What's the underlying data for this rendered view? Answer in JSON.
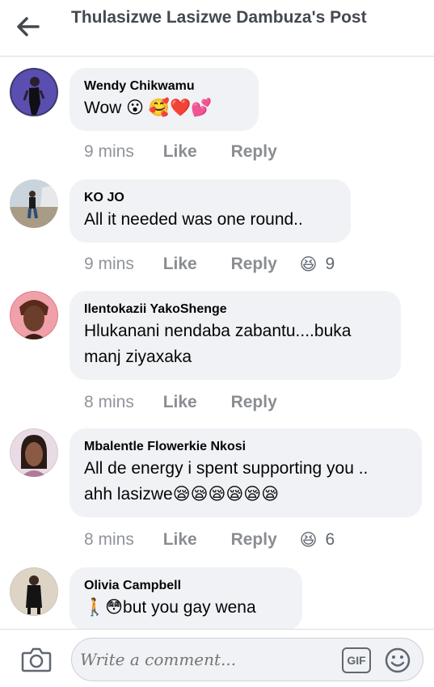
{
  "header": {
    "title": "Thulasizwe Lasizwe Dambuza's Post"
  },
  "comments": [
    {
      "author": "Wendy Chikwamu",
      "text": "Wow 😮 🥰❤️💕",
      "time": "9 mins",
      "like": "Like",
      "reply": "Reply",
      "reaction_count": ""
    },
    {
      "author": "KO JO",
      "text": "All it needed was one round..",
      "time": "9 mins",
      "like": "Like",
      "reply": "Reply",
      "reaction_emoji": "😆",
      "reaction_count": "9"
    },
    {
      "author": "Ilentokazii YakoShenge",
      "text": "Hlukanani nendaba zabantu....buka\nmanj ziyaxaka",
      "time": "8 mins",
      "like": "Like",
      "reply": "Reply",
      "reaction_count": ""
    },
    {
      "author": "Mbalentle Flowerkie Nkosi",
      "text": "All de energy i spent supporting you ..\nahh lasizwe😪😪😪😪😪😪",
      "time": "8 mins",
      "like": "Like",
      "reply": "Reply",
      "reaction_emoji": "😆",
      "reaction_count": "6"
    },
    {
      "author": "Olivia Campbell",
      "text": "🚶😳but you gay wena",
      "time": "",
      "like": "",
      "reply": "",
      "reaction_count": ""
    }
  ],
  "composer": {
    "placeholder": "Write a comment...",
    "gif_label": "GIF"
  },
  "icons": {
    "back": "arrow-left-icon",
    "camera": "camera-icon",
    "gif": "gif-icon",
    "sticker": "smiley-icon",
    "reaction": "laughing-face-icon"
  },
  "colors": {
    "bubble": "#f0f2f5",
    "meta_text": "#8a8d91",
    "title": "#444950"
  }
}
